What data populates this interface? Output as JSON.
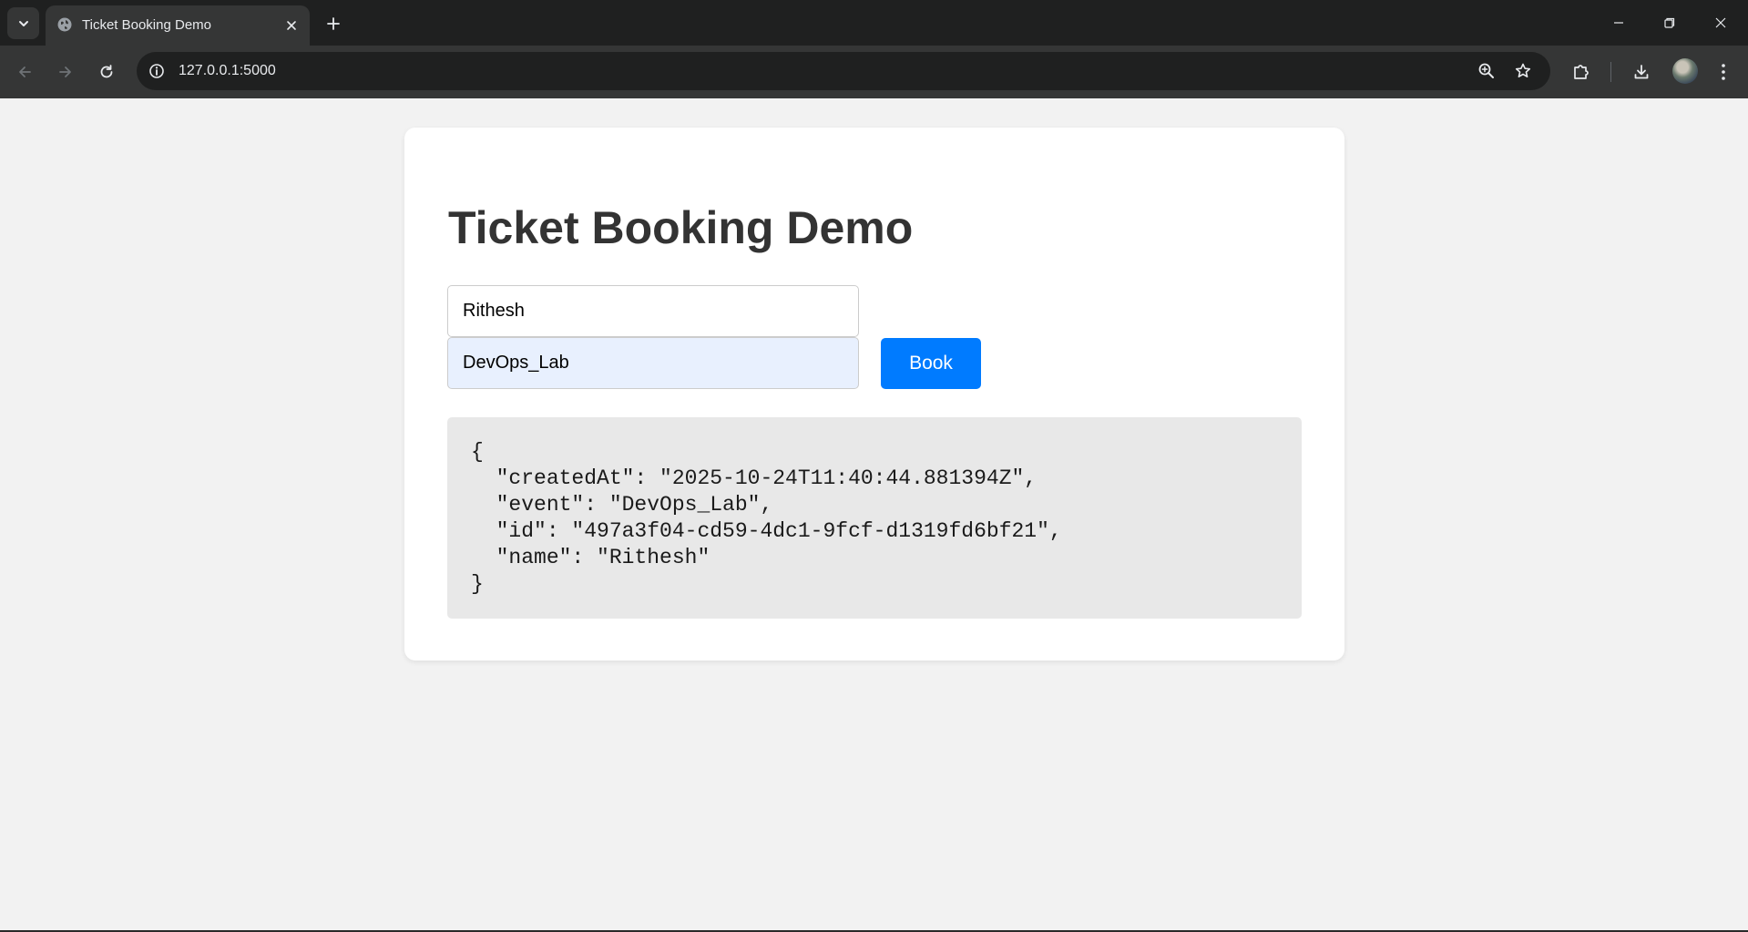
{
  "browser": {
    "tab": {
      "title": "Ticket Booking Demo",
      "favicon": "globe-icon"
    },
    "address_bar": {
      "url": "127.0.0.1:5000"
    },
    "icons": {
      "tab_search": "chevron-down-icon",
      "tab_close": "close-icon",
      "new_tab": "plus-icon",
      "minimize": "minimize-icon",
      "restore": "restore-icon",
      "close_window": "close-icon",
      "back": "arrow-left-icon",
      "forward": "arrow-right-icon",
      "reload": "reload-icon",
      "site_info": "info-icon",
      "zoom": "zoom-icon",
      "bookmark": "star-icon",
      "extensions": "puzzle-icon",
      "downloads": "download-icon",
      "menu": "kebab-menu-icon"
    }
  },
  "page": {
    "title": "Ticket Booking Demo",
    "form": {
      "name_value": "Rithesh",
      "event_value": "DevOps_Lab",
      "book_label": "Book"
    },
    "result": {
      "json_text": "{\n  \"createdAt\": \"2025-10-24T11:40:44.881394Z\",\n  \"event\": \"DevOps_Lab\",\n  \"id\": \"497a3f04-cd59-4dc1-9fcf-d1319fd6bf21\",\n  \"name\": \"Rithesh\"\n}"
    }
  },
  "colors": {
    "accent": "#007bff",
    "autofill_bg": "#e8f0fe",
    "page_bg": "#f2f2f2",
    "card_bg": "#ffffff",
    "result_bg": "#e8e8e8",
    "title_text": "#333333"
  }
}
